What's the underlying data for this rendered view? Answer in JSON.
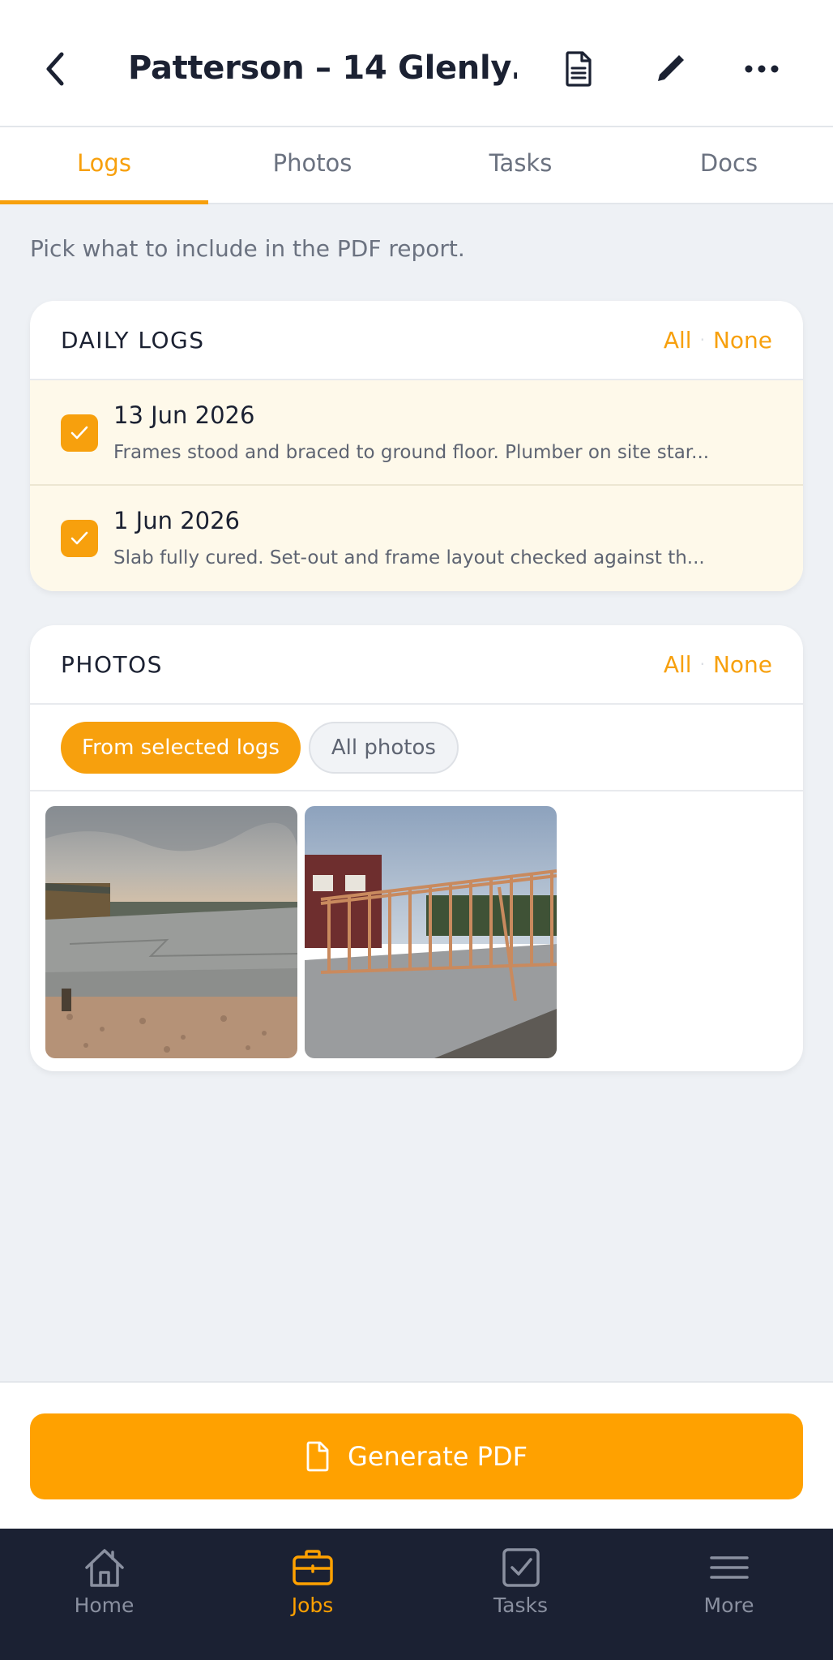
{
  "header": {
    "title": "Patterson – 14 Glenly…",
    "icons": [
      "back-arrow-icon",
      "document-icon",
      "pencil-icon",
      "more-icon"
    ]
  },
  "tabs": [
    {
      "label": "Logs",
      "active": true
    },
    {
      "label": "Photos",
      "active": false
    },
    {
      "label": "Tasks",
      "active": false
    },
    {
      "label": "Docs",
      "active": false
    }
  ],
  "hint": "Pick what to include in the PDF report.",
  "daily_logs": {
    "title": "DAILY LOGS",
    "all_label": "All",
    "separator": "·",
    "none_label": "None",
    "items": [
      {
        "date": "13 Jun 2026",
        "description": "Frames stood and braced to ground floor. Plumber on site star...",
        "checked": true
      },
      {
        "date": "1 Jun 2026",
        "description": "Slab fully cured. Set-out and frame layout checked against th...",
        "checked": true
      }
    ]
  },
  "photos": {
    "title": "PHOTOS",
    "all_label": "All",
    "separator": "·",
    "none_label": "None",
    "filters": [
      {
        "label": "From selected logs",
        "active": true
      },
      {
        "label": "All photos",
        "active": false
      }
    ],
    "thumbnails": [
      "concrete-slab-photo",
      "timber-frame-photo"
    ]
  },
  "generate_button": {
    "label": "Generate PDF",
    "icon": "file-icon"
  },
  "bottom_nav": [
    {
      "label": "Home",
      "icon": "home-icon",
      "active": false
    },
    {
      "label": "Jobs",
      "icon": "briefcase-icon",
      "active": true
    },
    {
      "label": "Tasks",
      "icon": "checkbox-icon",
      "active": false
    },
    {
      "label": "More",
      "icon": "menu-icon",
      "active": false
    }
  ],
  "colors": {
    "accent": "#FFA100",
    "nav_background": "#1B2133",
    "log_row_background": "#FEF9EA",
    "page_background": "#EEF1F5"
  }
}
